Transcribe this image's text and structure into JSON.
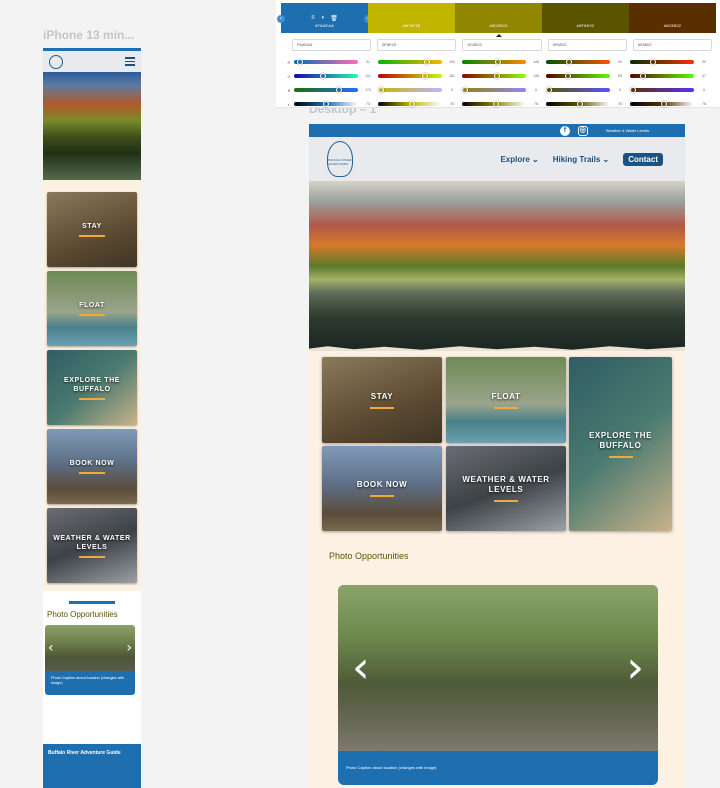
{
  "frames": {
    "mobile_label": "iPhone 13 min...",
    "desktop_label": "Desktop – 1"
  },
  "palette": {
    "swatches": [
      {
        "hex": "#F6AEAA",
        "color": "#1e6fb0",
        "selected": false
      },
      {
        "hex": "#6F6E1E",
        "color": "#c2b500",
        "selected": false
      },
      {
        "hex": "#9C8E02",
        "color": "#918600",
        "selected": true
      },
      {
        "hex": "#5F6E02",
        "color": "#5a5300",
        "selected": false
      },
      {
        "hex": "#603B02",
        "color": "#5a2f00",
        "selected": false
      }
    ],
    "hex_values": [
      "F6AEAA",
      "6F6E1E",
      "9C8E02",
      "5F6E02",
      "603B02"
    ],
    "channels": [
      "R",
      "G",
      "B",
      "◐"
    ],
    "values": [
      [
        "31",
        "111",
        "174",
        "73"
      ],
      [
        "194",
        "181",
        "0",
        "76"
      ],
      [
        "145",
        "134",
        "0",
        "76"
      ],
      [
        "90",
        "83",
        "0",
        "76"
      ],
      [
        "90",
        "47",
        "0",
        "76"
      ]
    ],
    "tools": [
      "≡",
      "◑",
      "🗑"
    ]
  },
  "mobile": {
    "tiles": [
      {
        "label": "STAY"
      },
      {
        "label": "FLOAT"
      },
      {
        "label": "EXPLORE THE BUFFALO"
      },
      {
        "label": "BOOK NOW"
      },
      {
        "label": "WEATHER & WATER LEVELS"
      }
    ],
    "photo_title": "Photo Opportunities",
    "photo_caption": "Photo Caption about location (changes with image)",
    "footer": "Buffalo River Adventure Guide",
    "chev_left": "‹",
    "chev_right": "›"
  },
  "desktop": {
    "topbar_link": "Weather & Water Levels",
    "icon_fb": "f",
    "icon_ig": "◎",
    "logo_text": "BUFFALO RIVER ADVENTURES",
    "nav": {
      "explore": "Explore ⌄",
      "trails": "Hiking Trails ⌄",
      "contact": "Contact"
    },
    "tiles": [
      {
        "label": "STAY"
      },
      {
        "label": "FLOAT"
      },
      {
        "label": "EXPLORE THE BUFFALO"
      },
      {
        "label": "BOOK NOW"
      },
      {
        "label": "WEATHER & WATER LEVELS"
      }
    ],
    "photo_title": "Photo Opportunities",
    "photo_caption": "Photo Caption about location (changes with image)",
    "chev_left": "‹",
    "chev_right": "›"
  }
}
